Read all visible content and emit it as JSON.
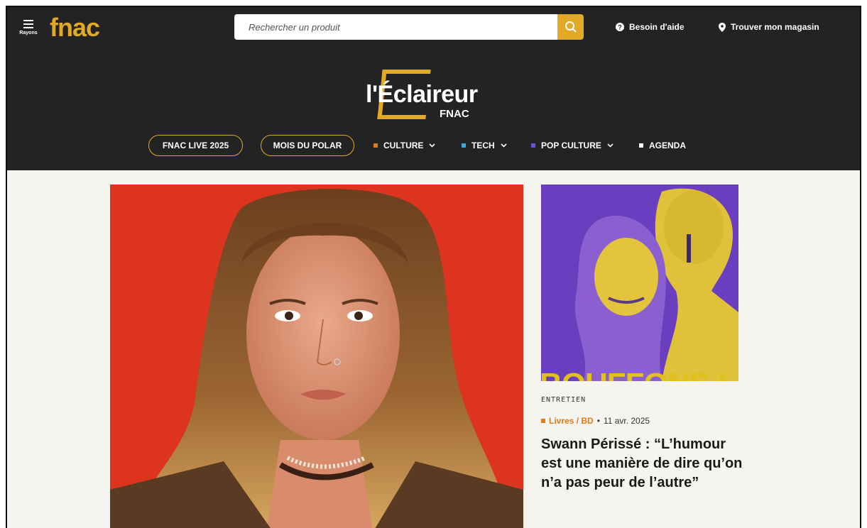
{
  "topbar": {
    "menu_label": "Rayons",
    "logo_text": "fnac",
    "search_placeholder": "Rechercher un produit",
    "help_label": "Besoin d'aide",
    "store_label": "Trouver mon magasin"
  },
  "brand": {
    "title": "l'Éclaireur",
    "subtitle": "FNAC"
  },
  "nav": {
    "pills": [
      "FNAC LIVE 2025",
      "MOIS DU POLAR"
    ],
    "categories": [
      {
        "label": "CULTURE",
        "color": "#e07a1a",
        "has_dropdown": true
      },
      {
        "label": "TECH",
        "color": "#3aa7d8",
        "has_dropdown": true
      },
      {
        "label": "POP CULTURE",
        "color": "#6b4fd6",
        "has_dropdown": true
      },
      {
        "label": "AGENDA",
        "color": "#ffffff",
        "has_dropdown": false
      }
    ]
  },
  "side_article": {
    "image_text": "BOUFFONS !",
    "type": "ENTRETIEN",
    "category": "Livres / BD",
    "date": "11 avr. 2025",
    "title": "Swann Périssé : “L’humour est une manière de dire qu’on n’a pas peur de l’autre”"
  },
  "colors": {
    "accent": "#e1a925",
    "header_bg": "#232323",
    "page_bg": "#f6f4ee"
  }
}
